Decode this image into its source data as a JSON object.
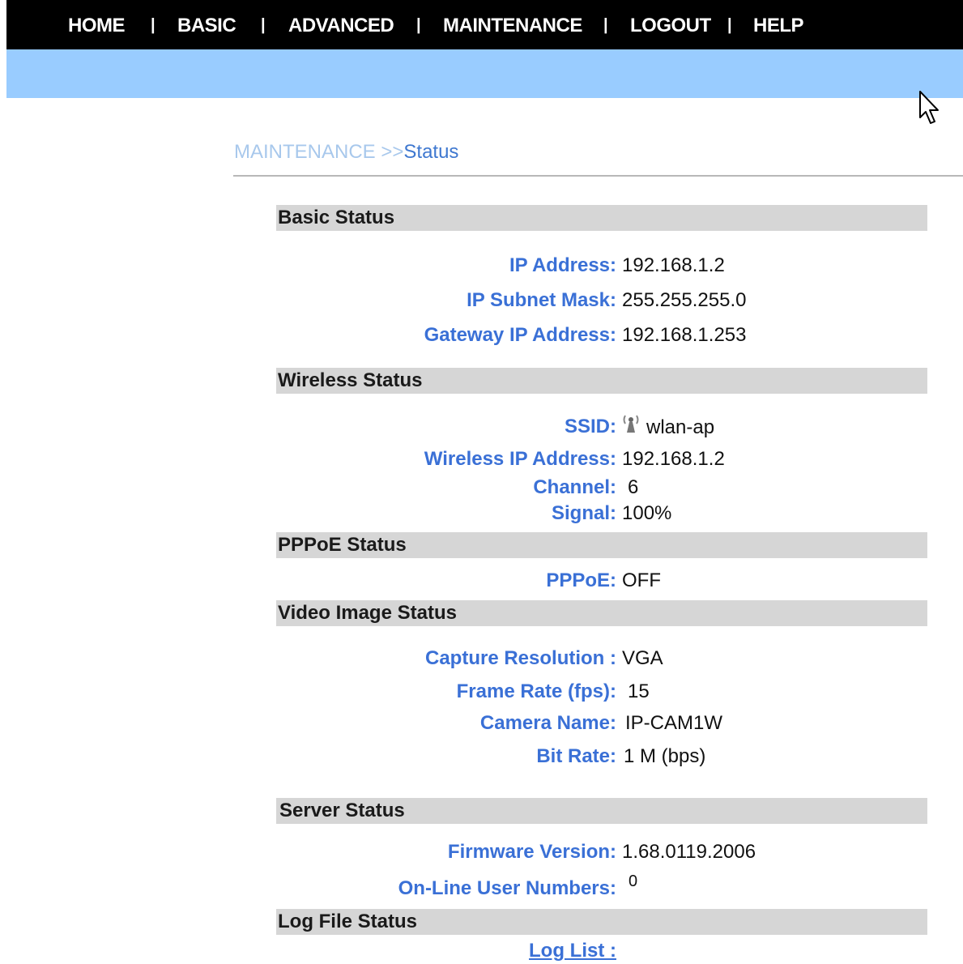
{
  "nav": {
    "items": [
      "HOME",
      "BASIC",
      "ADVANCED",
      "MAINTENANCE",
      "LOGOUT",
      "HELP"
    ],
    "separator": "|"
  },
  "breadcrumb": {
    "parent": "MAINTENANCE",
    "separator": ">>",
    "current": "Status"
  },
  "sections": {
    "basic": {
      "title": "Basic Status",
      "ip_label": "IP Address:",
      "ip_value": "192.168.1.2",
      "mask_label": "IP Subnet Mask:",
      "mask_value": "255.255.255.0",
      "gateway_label": "Gateway IP Address:",
      "gateway_value": "192.168.1.253"
    },
    "wireless": {
      "title": "Wireless Status",
      "ssid_label": "SSID:",
      "ssid_value": "wlan-ap",
      "wip_label": "Wireless IP Address:",
      "wip_value": "192.168.1.2",
      "channel_label": "Channel:",
      "channel_value": "6",
      "signal_label": "Signal:",
      "signal_value": "100%"
    },
    "pppoe": {
      "title": "PPPoE Status",
      "pppoe_label": "PPPoE:",
      "pppoe_value": "OFF"
    },
    "video": {
      "title": "Video Image Status",
      "res_label": "Capture Resolution :",
      "res_value": "VGA",
      "fps_label": "Frame Rate (fps):",
      "fps_value": "15",
      "cam_label": "Camera Name:",
      "cam_value": "IP-CAM1W",
      "bitrate_label": "Bit Rate:",
      "bitrate_value": "1 M (bps)"
    },
    "server": {
      "title": "Server Status",
      "fw_label": "Firmware Version:",
      "fw_value": "1.68.0119.2006",
      "users_label": "On-Line User Numbers:",
      "users_value": "0"
    },
    "log": {
      "title": "Log File Status",
      "link_label": "Log List :"
    }
  },
  "colors": {
    "nav_bg": "#000000",
    "band": "#99ccff",
    "label_blue": "#3a70d6",
    "section_bg": "#d6d6d6"
  },
  "icons": [
    "antenna-icon",
    "mouse-cursor-icon"
  ]
}
